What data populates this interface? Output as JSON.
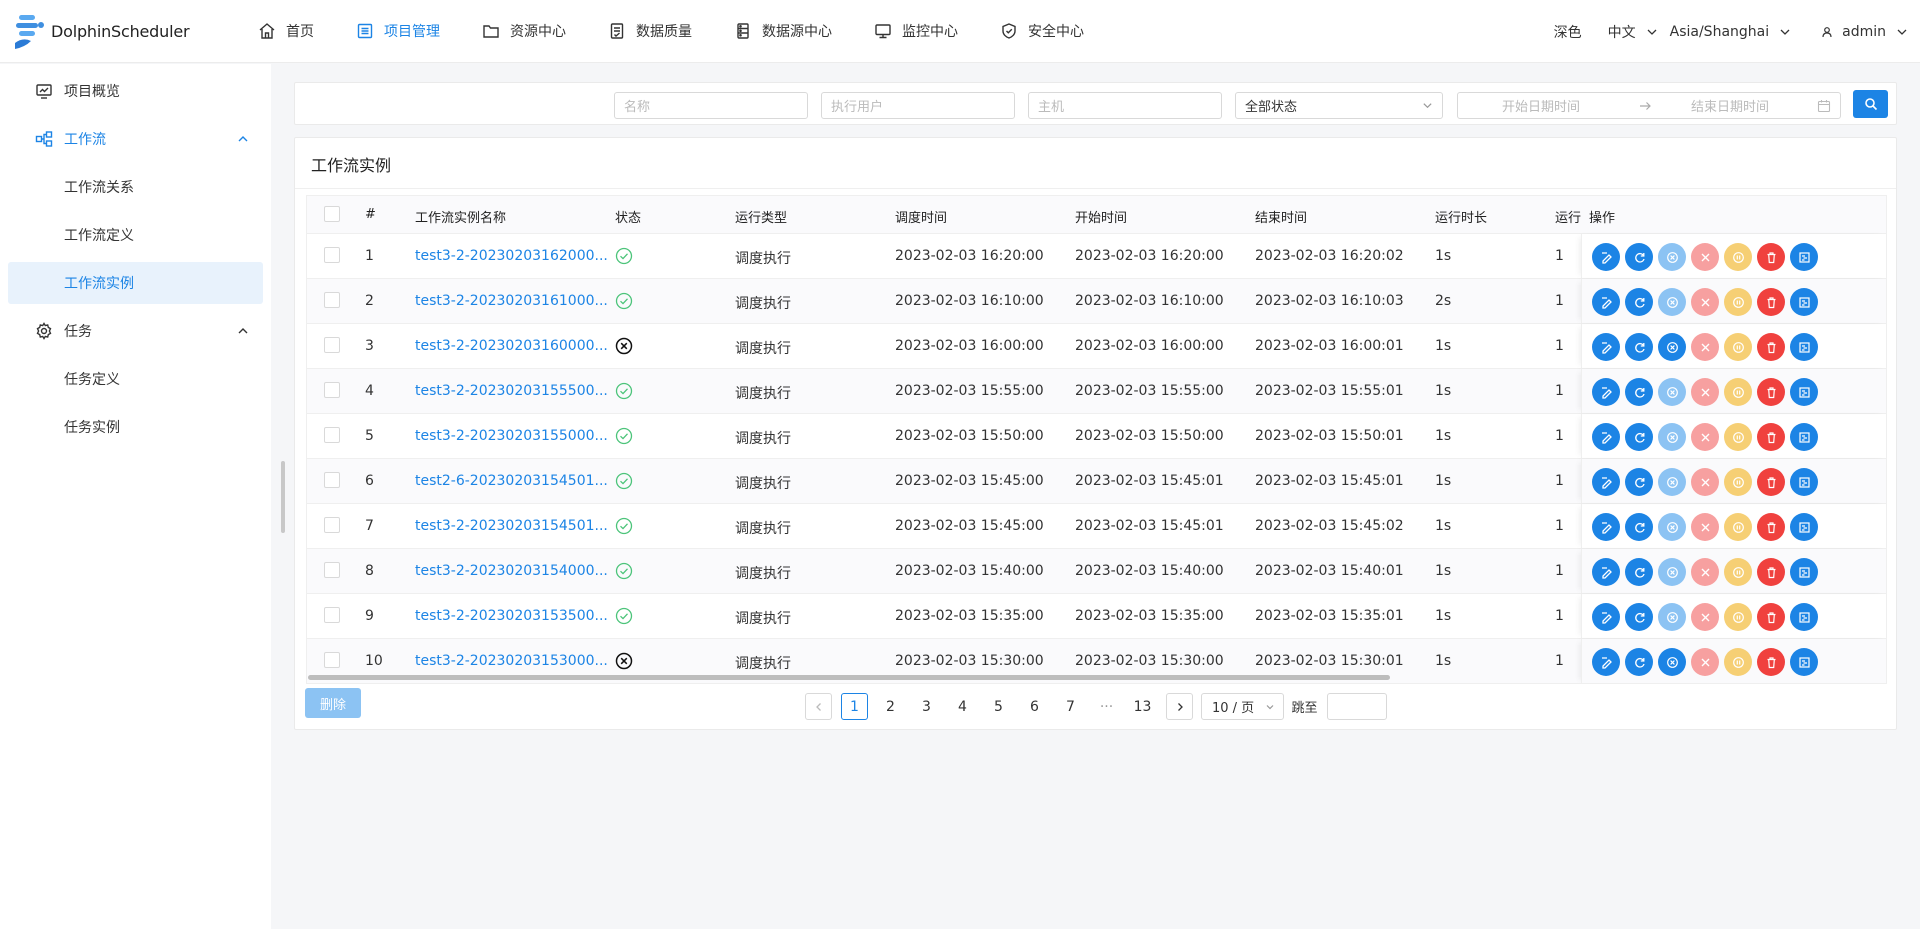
{
  "header": {
    "logo_text": "DolphinScheduler",
    "nav": [
      {
        "label": "首页",
        "icon": "home-icon"
      },
      {
        "label": "项目管理",
        "icon": "project-icon",
        "active": true
      },
      {
        "label": "资源中心",
        "icon": "folder-icon"
      },
      {
        "label": "数据质量",
        "icon": "data-quality-icon"
      },
      {
        "label": "数据源中心",
        "icon": "datasource-icon"
      },
      {
        "label": "监控中心",
        "icon": "monitor-icon"
      },
      {
        "label": "安全中心",
        "icon": "shield-icon"
      }
    ],
    "theme": "深色",
    "language": "中文",
    "timezone": "Asia/Shanghai",
    "user": "admin"
  },
  "sidebar": {
    "items": [
      {
        "label": "项目概览"
      },
      {
        "label": "工作流"
      },
      {
        "label": "工作流关系"
      },
      {
        "label": "工作流定义"
      },
      {
        "label": "工作流实例"
      },
      {
        "label": "任务"
      },
      {
        "label": "任务定义"
      },
      {
        "label": "任务实例"
      }
    ]
  },
  "filters": {
    "name_placeholder": "名称",
    "user_placeholder": "执行用户",
    "host_placeholder": "主机",
    "status_value": "全部状态",
    "start_placeholder": "开始日期时间",
    "end_placeholder": "结束日期时间"
  },
  "card": {
    "title": "工作流实例"
  },
  "table": {
    "columns": [
      "#",
      "工作流实例名称",
      "状态",
      "运行类型",
      "调度时间",
      "开始时间",
      "结束时间",
      "运行时长",
      "运行",
      "操作"
    ],
    "rows": [
      {
        "idx": "1",
        "name": "test3-2-20230203162000...",
        "status": "success",
        "type": "调度执行",
        "schedule": "2023-02-03 16:20:00",
        "start": "2023-02-03 16:20:00",
        "end": "2023-02-03 16:20:02",
        "duration": "1s",
        "runs": "1",
        "stop_active": false
      },
      {
        "idx": "2",
        "name": "test3-2-20230203161000...",
        "status": "success",
        "type": "调度执行",
        "schedule": "2023-02-03 16:10:00",
        "start": "2023-02-03 16:10:00",
        "end": "2023-02-03 16:10:03",
        "duration": "2s",
        "runs": "1",
        "stop_active": false
      },
      {
        "idx": "3",
        "name": "test3-2-20230203160000...",
        "status": "failure",
        "type": "调度执行",
        "schedule": "2023-02-03 16:00:00",
        "start": "2023-02-03 16:00:00",
        "end": "2023-02-03 16:00:01",
        "duration": "1s",
        "runs": "1",
        "stop_active": true
      },
      {
        "idx": "4",
        "name": "test3-2-20230203155500...",
        "status": "success",
        "type": "调度执行",
        "schedule": "2023-02-03 15:55:00",
        "start": "2023-02-03 15:55:00",
        "end": "2023-02-03 15:55:01",
        "duration": "1s",
        "runs": "1",
        "stop_active": false
      },
      {
        "idx": "5",
        "name": "test3-2-20230203155000...",
        "status": "success",
        "type": "调度执行",
        "schedule": "2023-02-03 15:50:00",
        "start": "2023-02-03 15:50:00",
        "end": "2023-02-03 15:50:01",
        "duration": "1s",
        "runs": "1",
        "stop_active": false
      },
      {
        "idx": "6",
        "name": "test2-6-20230203154501...",
        "status": "success",
        "type": "调度执行",
        "schedule": "2023-02-03 15:45:00",
        "start": "2023-02-03 15:45:01",
        "end": "2023-02-03 15:45:01",
        "duration": "1s",
        "runs": "1",
        "stop_active": false
      },
      {
        "idx": "7",
        "name": "test3-2-20230203154501...",
        "status": "success",
        "type": "调度执行",
        "schedule": "2023-02-03 15:45:00",
        "start": "2023-02-03 15:45:01",
        "end": "2023-02-03 15:45:02",
        "duration": "1s",
        "runs": "1",
        "stop_active": false
      },
      {
        "idx": "8",
        "name": "test3-2-20230203154000...",
        "status": "success",
        "type": "调度执行",
        "schedule": "2023-02-03 15:40:00",
        "start": "2023-02-03 15:40:00",
        "end": "2023-02-03 15:40:01",
        "duration": "1s",
        "runs": "1",
        "stop_active": false
      },
      {
        "idx": "9",
        "name": "test3-2-20230203153500...",
        "status": "success",
        "type": "调度执行",
        "schedule": "2023-02-03 15:35:00",
        "start": "2023-02-03 15:35:00",
        "end": "2023-02-03 15:35:01",
        "duration": "1s",
        "runs": "1",
        "stop_active": false
      },
      {
        "idx": "10",
        "name": "test3-2-20230203153000...",
        "status": "failure",
        "type": "调度执行",
        "schedule": "2023-02-03 15:30:00",
        "start": "2023-02-03 15:30:00",
        "end": "2023-02-03 15:30:01",
        "duration": "1s",
        "runs": "1",
        "stop_active": true
      }
    ]
  },
  "actions": [
    "edit-icon",
    "rerun-icon",
    "stop-icon",
    "failover-icon",
    "pause-icon",
    "delete-icon",
    "gantt-icon"
  ],
  "colors": {
    "primary": "#1c84e5",
    "primary_light": "#8cc3f3",
    "danger": "#f0413e",
    "danger_light": "#f7a0a0",
    "warning_light": "#f6cf74",
    "success": "#4cc47a"
  },
  "footer": {
    "delete_label": "删除",
    "pages": [
      "1",
      "2",
      "3",
      "4",
      "5",
      "6",
      "7",
      "···",
      "13"
    ],
    "current_page": "1",
    "page_size": "10 / 页",
    "jump_label": "跳至"
  }
}
